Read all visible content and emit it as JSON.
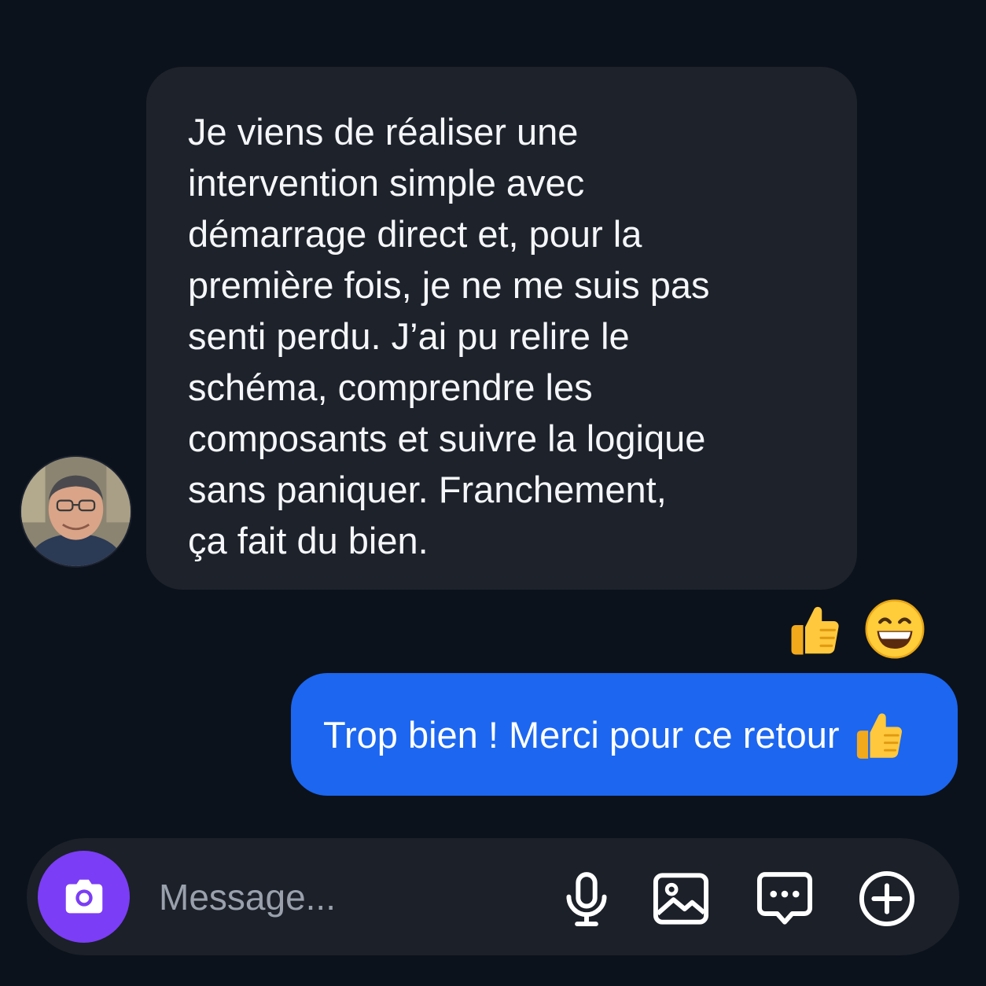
{
  "conversation": {
    "incoming": {
      "avatar_icon": "user-avatar",
      "lines": [
        "Je viens de réaliser une",
        "intervention simple avec",
        "démarrage direct et, pour la",
        "première fois, je ne me suis pas",
        "senti perdu. J’ai pu relire le",
        "schéma, comprendre les",
        "composants et suivre la logique",
        "sans paniquer. Franchement,",
        "ça fait du bien."
      ],
      "bubble_color": "#1d222b",
      "reactions": [
        "thumbs-up-emoji",
        "grinning-face-emoji"
      ]
    },
    "outgoing": {
      "text": "Trop bien ! Merci pour ce retour",
      "emoji": "thumbs-up-emoji",
      "bubble_color": "#1c66f0"
    }
  },
  "composer": {
    "placeholder": "Message...",
    "camera_icon": "camera-icon",
    "camera_button_color": "#7b3df5",
    "tools": [
      "microphone-icon",
      "image-icon",
      "chat-bubble-icon",
      "plus-circle-icon"
    ]
  },
  "theme": {
    "background": "#0c121b"
  }
}
